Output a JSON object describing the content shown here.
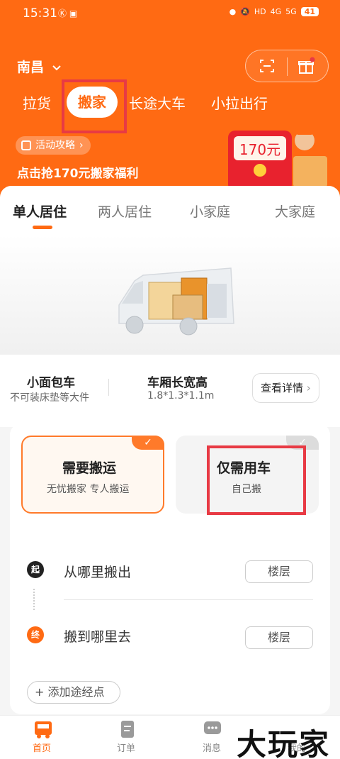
{
  "status": {
    "time": "15:31",
    "net1": "4G",
    "net2": "5G",
    "battery": "41",
    "hd": "HD"
  },
  "header": {
    "city": "南昌",
    "nav": [
      "拉货",
      "搬家",
      "长途大车",
      "小拉出行"
    ],
    "promo_pill": "活动攻略",
    "promo_text": "点击抢170元搬家福利",
    "coupon": "170元"
  },
  "categories": [
    "单人居住",
    "两人居住",
    "小家庭",
    "大家庭"
  ],
  "vehicle": {
    "name": "小面包车",
    "note": "不可装床垫等大件",
    "dims_label": "车厢长宽高",
    "dims": "1.8*1.3*1.1m",
    "details_button": "查看详情"
  },
  "options": [
    {
      "title": "需要搬运",
      "sub": "无忧搬家 专人搬运",
      "selected": true
    },
    {
      "title": "仅需用车",
      "sub": "自己搬",
      "selected": false
    }
  ],
  "route": {
    "start_badge": "起",
    "start_label": "从哪里搬出",
    "end_badge": "终",
    "end_label": "搬到哪里去",
    "floor_label": "楼层",
    "add_stop": "+ 添加途经点"
  },
  "tabs": [
    "首页",
    "订单",
    "消息",
    "我的"
  ],
  "watermark": "大玩家",
  "colors": {
    "brand": "#ff6a13",
    "highlight_box": "#e83a44"
  }
}
